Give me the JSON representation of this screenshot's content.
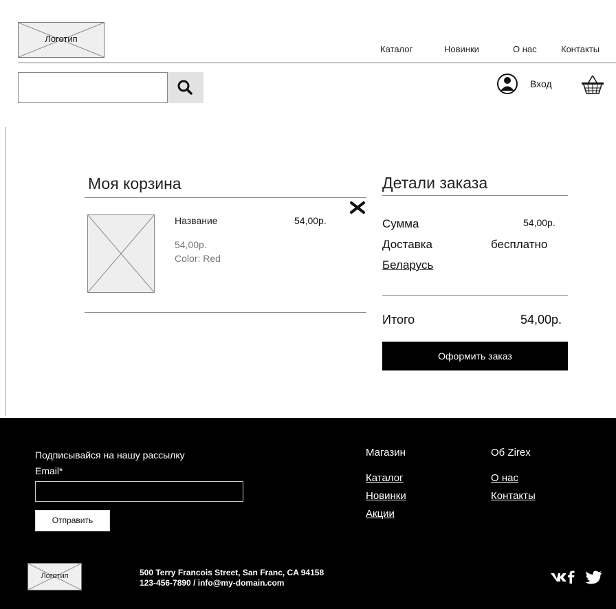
{
  "header": {
    "logo_text": "Логотип",
    "nav": [
      "Каталог",
      "Новинки",
      "О нас",
      "Контакты"
    ],
    "search": {
      "placeholder": ""
    },
    "login_label": "Вход"
  },
  "cart": {
    "title": "Моя корзина",
    "item": {
      "name": "Название",
      "price": "54,00р.",
      "sub_price": "54,00р.",
      "color": "Color: Red"
    }
  },
  "order": {
    "title": "Детали заказа",
    "sum_label": "Сумма",
    "sum_value": "54,00р.",
    "delivery_label": "Доставка",
    "delivery_value": "бесплатно",
    "country": "Беларусь",
    "total_label": "Итого",
    "total_value": "54,00р.",
    "checkout_label": "Оформить заказ"
  },
  "footer": {
    "subscribe_title": "Подписывайся на нашу рассылку",
    "email_label": "Email*",
    "email_placeholder": "",
    "send_label": "Отправить",
    "shop_title": "Магазин",
    "shop_links": [
      "Каталог",
      "Новинки",
      "Акции"
    ],
    "about_title": "Об Zirex",
    "about_links": [
      "О нас",
      "Контакты"
    ],
    "logo_text": "Логотип",
    "address": "500 Terry Francois Street, San Franc, CA 94158",
    "contacts": "123-456-7890 / info@my-domain.com"
  }
}
